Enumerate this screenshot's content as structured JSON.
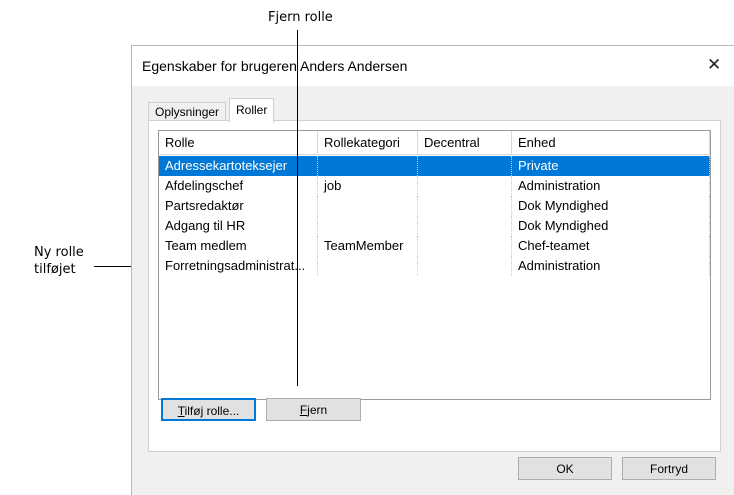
{
  "callouts": {
    "top": "Fjern rolle",
    "left_line1": "Ny rolle",
    "left_line2": "tilføjet"
  },
  "dialog": {
    "title": "Egenskaber for brugeren Anders Andersen",
    "close_glyph": "✕",
    "tabs": [
      "Oplysninger",
      "Roller"
    ],
    "active_tab": "Roller",
    "columns": [
      "Rolle",
      "Rollekategori",
      "Decentral",
      "Enhed"
    ],
    "rows": [
      {
        "rolle": "Adressekartoteksejer",
        "kategori": "",
        "decentral": false,
        "enhed": "Private"
      },
      {
        "rolle": "Afdelingschef",
        "kategori": "job",
        "decentral": false,
        "enhed": "Administration"
      },
      {
        "rolle": "Partsredaktør",
        "kategori": "",
        "decentral": false,
        "enhed": "Dok Myndighed"
      },
      {
        "rolle": "Adgang til HR",
        "kategori": "",
        "decentral": false,
        "enhed": "Dok Myndighed"
      },
      {
        "rolle": "Team medlem",
        "kategori": "TeamMember",
        "decentral": false,
        "enhed": "Chef-teamet"
      },
      {
        "rolle": "Forretningsadministrat...",
        "kategori": "",
        "decentral": false,
        "enhed": "Administration"
      }
    ],
    "selected_row": 0,
    "buttons": {
      "add_mnemonic": "T",
      "add_rest": "ilføj rolle...",
      "remove_mnemonic": "F",
      "remove_rest": "jern",
      "ok": "OK",
      "cancel": "Fortryd"
    },
    "colors": {
      "selection": "#0078d7",
      "focus_border": "#0078d7"
    }
  }
}
